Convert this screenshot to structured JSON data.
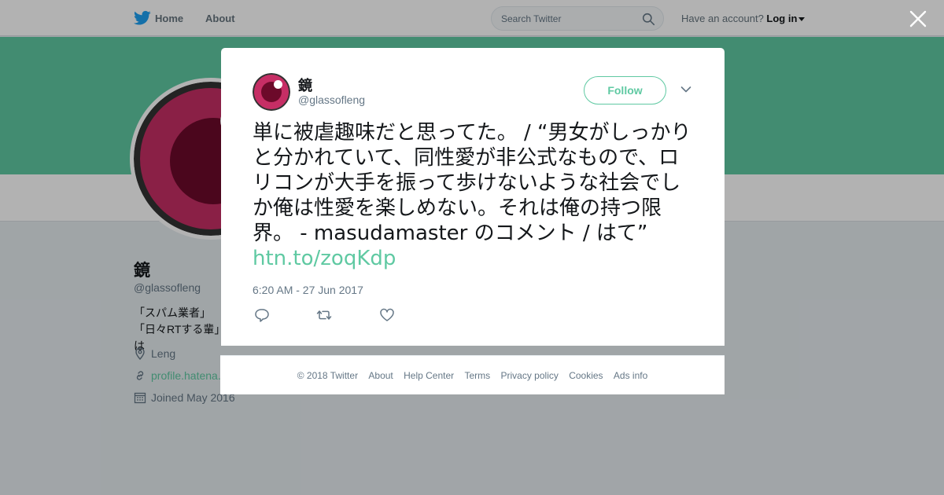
{
  "nav": {
    "home": "Home",
    "about": "About",
    "search_placeholder": "Search Twitter",
    "have_account": "Have an account?",
    "login": "Log in"
  },
  "profile": {
    "name": "鏡",
    "handle": "@glassofleng",
    "bio": "「スパム業者」「日々RTする輩」は",
    "location": "Leng",
    "url": "profile.hatena.",
    "joined": "Joined May 2016"
  },
  "tweet": {
    "author_name": "鏡",
    "author_handle": "@glassofleng",
    "follow_label": "Follow",
    "text": "単に被虐趣味だと思ってた。 / “男女がしっかりと分かれていて、同性愛が非公式なもので、ロリコンが大手を振って歩けないような社会でしか俺は性愛を楽しめない。それは俺の持つ限界。 - masudamaster のコメント / はて” ",
    "link": "htn.to/zoqKdp",
    "timestamp": "6:20 AM - 27 Jun 2017"
  },
  "footer": {
    "links": [
      "© 2018 Twitter",
      "About",
      "Help Center",
      "Terms",
      "Privacy policy",
      "Cookies",
      "Ads info"
    ]
  },
  "colors": {
    "accent": "#5fc9a2",
    "banner": "#5fc9a2",
    "avatar_pink": "#c62e65",
    "avatar_dark": "#6c0a2a"
  },
  "icons": {
    "bird": "twitter-bird-icon",
    "search": "search-icon",
    "close": "close-icon",
    "chevron": "chevron-down-icon",
    "reply": "reply-icon",
    "retweet": "retweet-icon",
    "like": "heart-icon",
    "location": "location-icon",
    "link": "link-icon",
    "calendar": "calendar-icon"
  }
}
